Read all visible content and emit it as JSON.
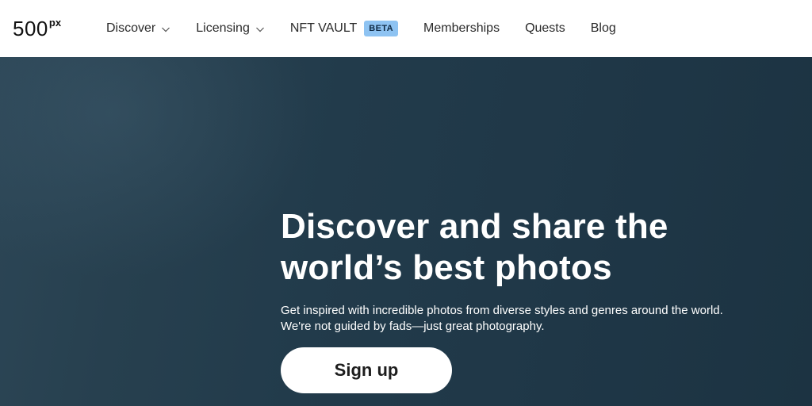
{
  "header": {
    "logo": {
      "main": "500",
      "sup": "px"
    },
    "nav": [
      {
        "label": "Discover",
        "has_dropdown": true
      },
      {
        "label": "Licensing",
        "has_dropdown": true
      },
      {
        "label": "NFT VAULT",
        "badge": "BETA"
      },
      {
        "label": "Memberships"
      },
      {
        "label": "Quests"
      },
      {
        "label": "Blog"
      }
    ]
  },
  "hero": {
    "title": "Discover and share the world’s best photos",
    "subtitle": "Get inspired with incredible photos from diverse styles and genres around the world. We're not guided by fads—just great photography.",
    "cta_label": "Sign up"
  },
  "colors": {
    "hero_bg": "#223b4b",
    "beta_badge_bg": "#8ec3f2",
    "text_dark": "#2b2b2b",
    "white": "#ffffff"
  },
  "icons": {
    "dropdown": "chevron-down-icon"
  }
}
